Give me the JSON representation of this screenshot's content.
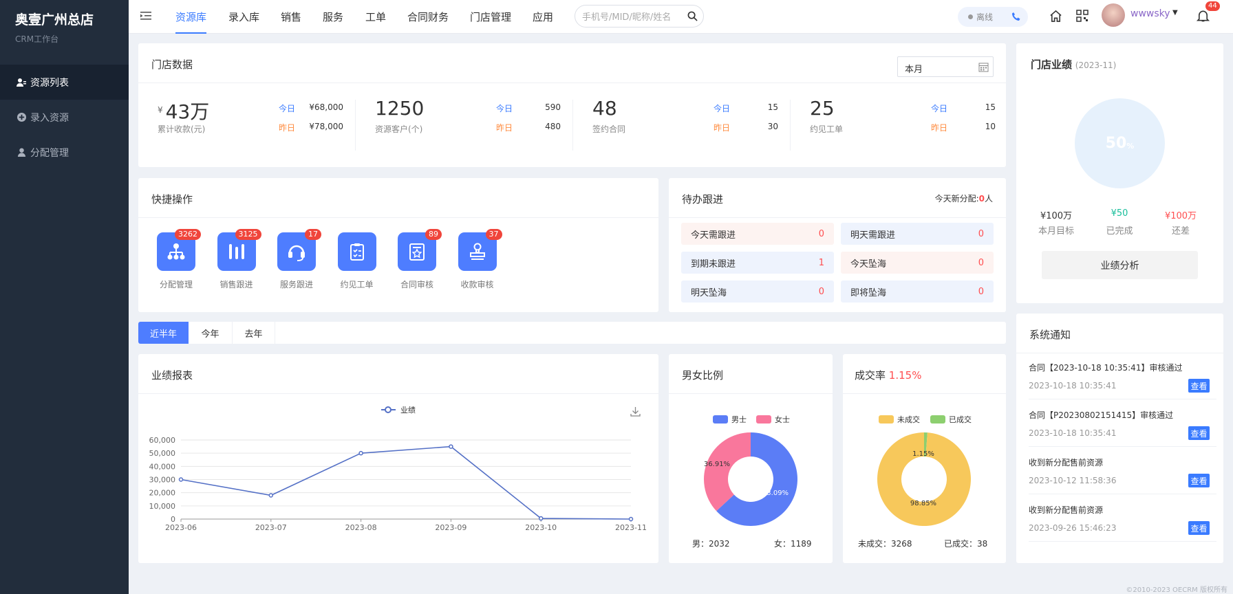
{
  "sidebar": {
    "brand": "奥壹广州总店",
    "subtitle": "CRM工作台",
    "items": [
      {
        "label": "资源列表",
        "icon": "user-list-icon"
      },
      {
        "label": "录入资源",
        "icon": "plus-circle-icon"
      },
      {
        "label": "分配管理",
        "icon": "assign-user-icon"
      }
    ]
  },
  "topbar": {
    "nav": [
      "资源库",
      "录入库",
      "销售",
      "服务",
      "工单",
      "合同财务",
      "门店管理",
      "应用"
    ],
    "search_placeholder": "手机号/MID/昵称/姓名",
    "status": "离线",
    "username": "wwwsky",
    "bell_count": "44"
  },
  "store_data": {
    "title": "门店数据",
    "period": "本月",
    "today_label": "今日",
    "yesterday_label": "昨日",
    "stats": [
      {
        "prefix": "¥",
        "value": "43万",
        "label": "累计收款(元)",
        "today": "¥68,000",
        "yesterday": "¥78,000"
      },
      {
        "prefix": "",
        "value": "1250",
        "label": "资源客户(个)",
        "today": "590",
        "yesterday": "480"
      },
      {
        "prefix": "",
        "value": "48",
        "label": "签约合同",
        "today": "15",
        "yesterday": "30"
      },
      {
        "prefix": "",
        "value": "25",
        "label": "约见工单",
        "today": "15",
        "yesterday": "10"
      }
    ]
  },
  "quick_ops": {
    "title": "快捷操作",
    "items": [
      {
        "label": "分配管理",
        "badge": "3262",
        "icon": "org-chart-icon"
      },
      {
        "label": "销售跟进",
        "badge": "3125",
        "icon": "bars-icon"
      },
      {
        "label": "服务跟进",
        "badge": "17",
        "icon": "headset-icon"
      },
      {
        "label": "约见工单",
        "badge": "",
        "icon": "clipboard-check-icon"
      },
      {
        "label": "合同审核",
        "badge": "89",
        "icon": "contract-star-icon"
      },
      {
        "label": "收款审核",
        "badge": "37",
        "icon": "stamp-icon"
      }
    ]
  },
  "todo": {
    "title": "待办跟进",
    "new_today_label": "今天新分配:",
    "new_today_value": "0",
    "new_today_unit": "人",
    "items": [
      {
        "label": "今天需跟进",
        "value": "0"
      },
      {
        "label": "明天需跟进",
        "value": "0"
      },
      {
        "label": "到期未跟进",
        "value": "1"
      },
      {
        "label": "今天坠海",
        "value": "0"
      },
      {
        "label": "明天坠海",
        "value": "0"
      },
      {
        "label": "即将坠海",
        "value": "0"
      }
    ]
  },
  "performance": {
    "title": "门店业绩",
    "period": "(2023-11)",
    "percent": "50",
    "percent_unit": "%",
    "target": "¥100万",
    "target_label": "本月目标",
    "done": "¥50",
    "done_label": "已完成",
    "remain": "¥100万",
    "remain_label": "还差",
    "analysis_button": "业绩分析",
    "colors": {
      "done": "#19be9b",
      "remain": "#ff4d4f"
    }
  },
  "range_tabs": [
    "近半年",
    "今年",
    "去年"
  ],
  "report": {
    "title": "业绩报表",
    "legend": "业绩"
  },
  "gender": {
    "title": "男女比例",
    "male_label": "男士",
    "female_label": "女士",
    "male_pct": "63.09%",
    "female_pct": "36.91%",
    "male_total": "男：2032",
    "female_total": "女：1189"
  },
  "deal": {
    "title": "成交率",
    "rate": "1.15%",
    "no_deal_label": "未成交",
    "deal_label": "已成交",
    "no_deal_pct": "98.85%",
    "deal_pct": "1.15%",
    "no_deal_total": "未成交：3268",
    "deal_total": "已成交：38"
  },
  "notices": {
    "title": "系统通知",
    "view_label": "查看",
    "items": [
      {
        "text": "合同【2023-10-18 10:35:41】审核通过",
        "time": "2023-10-18 10:35:41"
      },
      {
        "text": "合同【P20230802151415】审核通过",
        "time": "2023-10-18 10:35:41"
      },
      {
        "text": "收到新分配售前资源",
        "time": "2023-10-12 11:58:36"
      },
      {
        "text": "收到新分配售前资源",
        "time": "2023-09-26 15:46:23"
      }
    ]
  },
  "footer": "©2010-2023 OECRM 版权所有",
  "chart_data": [
    {
      "type": "line",
      "title": "",
      "categories": [
        "2023-06",
        "2023-07",
        "2023-08",
        "2023-09",
        "2023-10",
        "2023-11"
      ],
      "series": [
        {
          "name": "业绩",
          "values": [
            30000,
            18000,
            50000,
            55000,
            500,
            0
          ]
        }
      ],
      "ylim": [
        0,
        60000
      ],
      "yticks": [
        "0",
        "10,000",
        "20,000",
        "30,000",
        "40,000",
        "50,000",
        "60,000"
      ],
      "grid": true,
      "legend": "top-center",
      "color": "#5470c6"
    },
    {
      "type": "pie",
      "title": "男女比例",
      "slices": [
        {
          "name": "男士",
          "value": 63.09,
          "color": "#5b7df6"
        },
        {
          "name": "女士",
          "value": 36.91,
          "color": "#f9779c"
        }
      ]
    },
    {
      "type": "pie",
      "title": "成交率",
      "slices": [
        {
          "name": "未成交",
          "value": 98.85,
          "color": "#f7c85b"
        },
        {
          "name": "已成交",
          "value": 1.15,
          "color": "#8dcf6f"
        }
      ]
    }
  ]
}
